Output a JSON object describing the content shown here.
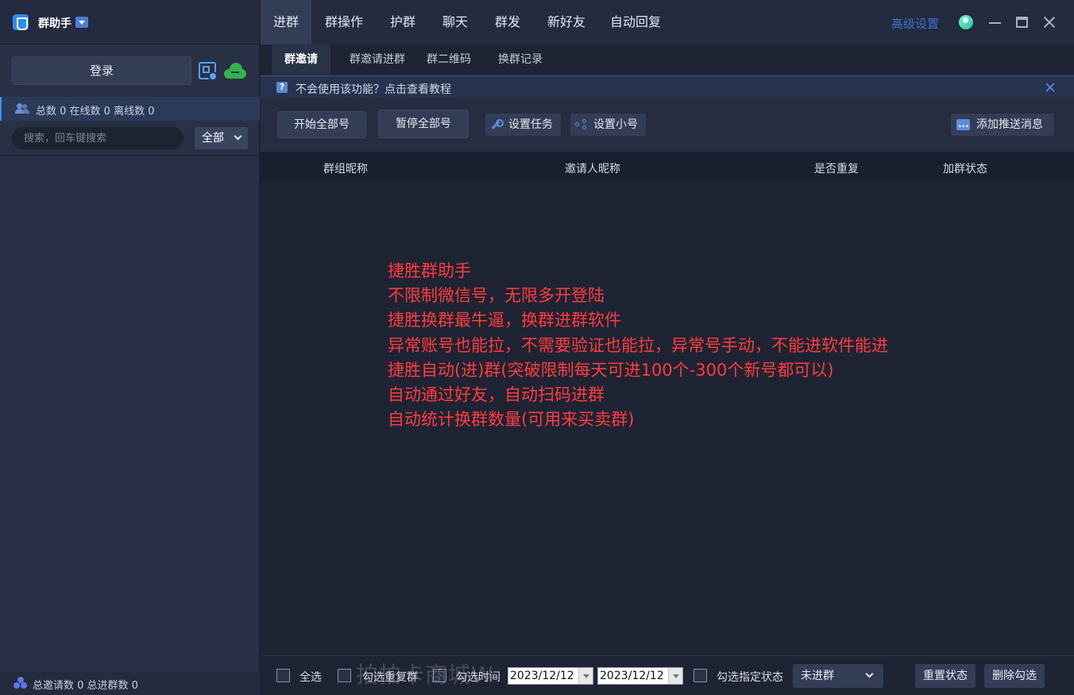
{
  "sidebar": {
    "app_name": "群助手",
    "login_label": "登录",
    "stats_text": "总数 0 在线数 0 离线数 0",
    "search_placeholder": "搜索，回车键搜索",
    "filter_value": "全部",
    "footer_text": "总邀请数 0 总进群数 0"
  },
  "nav": {
    "tabs": [
      {
        "label": "进群",
        "active": true
      },
      {
        "label": "群操作"
      },
      {
        "label": "护群"
      },
      {
        "label": "聊天"
      },
      {
        "label": "群发"
      },
      {
        "label": "新好友"
      },
      {
        "label": "自动回复"
      }
    ],
    "advanced_settings": "高级设置"
  },
  "subtabs": [
    {
      "label": "群邀请",
      "active": true
    },
    {
      "label": "群邀请进群"
    },
    {
      "label": "群二维码"
    },
    {
      "label": "换群记录"
    }
  ],
  "notice": {
    "text": "不会使用该功能？点击查看教程"
  },
  "toolbar": {
    "start_all": "开始全部号",
    "pause_all": "暂停全部号",
    "set_task": "设置任务",
    "set_account": "设置小号",
    "add_push": "添加推送消息"
  },
  "table": {
    "columns": [
      "群组昵称",
      "邀请人昵称",
      "是否重复",
      "加群状态"
    ],
    "rows": []
  },
  "promo": {
    "lines": [
      "捷胜群助手",
      "不限制微信号，无限多开登陆",
      "捷胜换群最牛逼，换群进群软件",
      "异常账号也能拉，不需要验证也能拉，异常号手动，不能进软件能进",
      "捷胜自动(进)群(突破限制每天可进100个-300个新号都可以)",
      "自动通过好友，自动扫码进群",
      "自动统计换群数量(可用来买卖群)"
    ],
    "color": "#ff3b3b"
  },
  "bottom": {
    "select_all": "全选",
    "select_duplicate": "勾选重复群",
    "select_time": "勾选时间",
    "date_from": "2023/12/12",
    "date_to": "2023/12/12",
    "select_status": "勾选指定状态",
    "status_value": "未进群",
    "reset_status": "重置状态",
    "delete_selected": "删除勾选",
    "watermark": "拍拍卡商城W"
  }
}
